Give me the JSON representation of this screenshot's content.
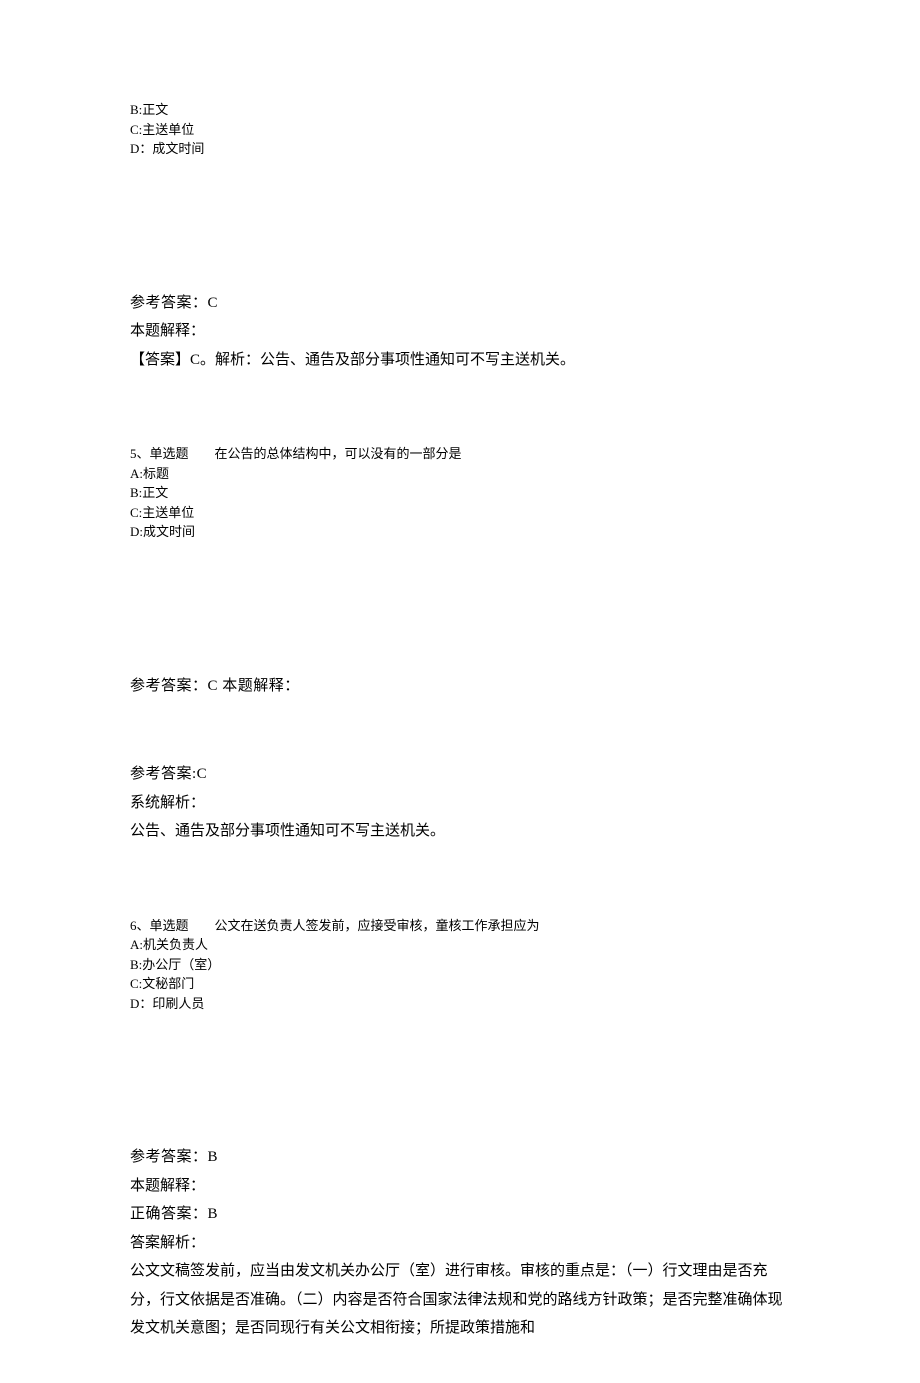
{
  "q4_partial": {
    "option_b": "B:正文",
    "option_c": "C:主送单位",
    "option_d": "D：成文时间",
    "answer_label": "参考答案：C",
    "explain_label": "本题解释：",
    "explain_text": "【答案】C。解析：公告、通告及部分事项性通知可不写主送机关。"
  },
  "q5": {
    "header": "5、单选题　　在公告的总体结构中，可以没有的一部分是",
    "option_a": "A:标题",
    "option_b": "B:正文",
    "option_c": "C:主送单位",
    "option_d": "D:成文时间",
    "answer1": "参考答案：C 本题解释：",
    "answer2_label": "参考答案:C",
    "analysis_label": "系统解析：",
    "analysis_text": "公告、通告及部分事项性通知可不写主送机关。"
  },
  "q6": {
    "header": "6、单选题　　公文在送负责人签发前，应接受审核，童核工作承担应为",
    "option_a": "A:机关负责人",
    "option_b": "B:办公厅（室）",
    "option_c": "C:文秘部门",
    "option_d": "D：印刷人员",
    "answer_label": "参考答案：B",
    "explain_label": "本题解释：",
    "correct_label": "正确答案：B",
    "analysis_label": "答案解析：",
    "analysis_text": "公文文稿签发前，应当由发文机关办公厅（室）进行审核。审核的重点是：（一）行文理由是否充分，行文依据是否准确。（二）内容是否符合国家法律法规和党的路线方针政策；是否完整准确体现发文机关意图；是否同现行有关公文相衔接；所提政策措施和"
  }
}
